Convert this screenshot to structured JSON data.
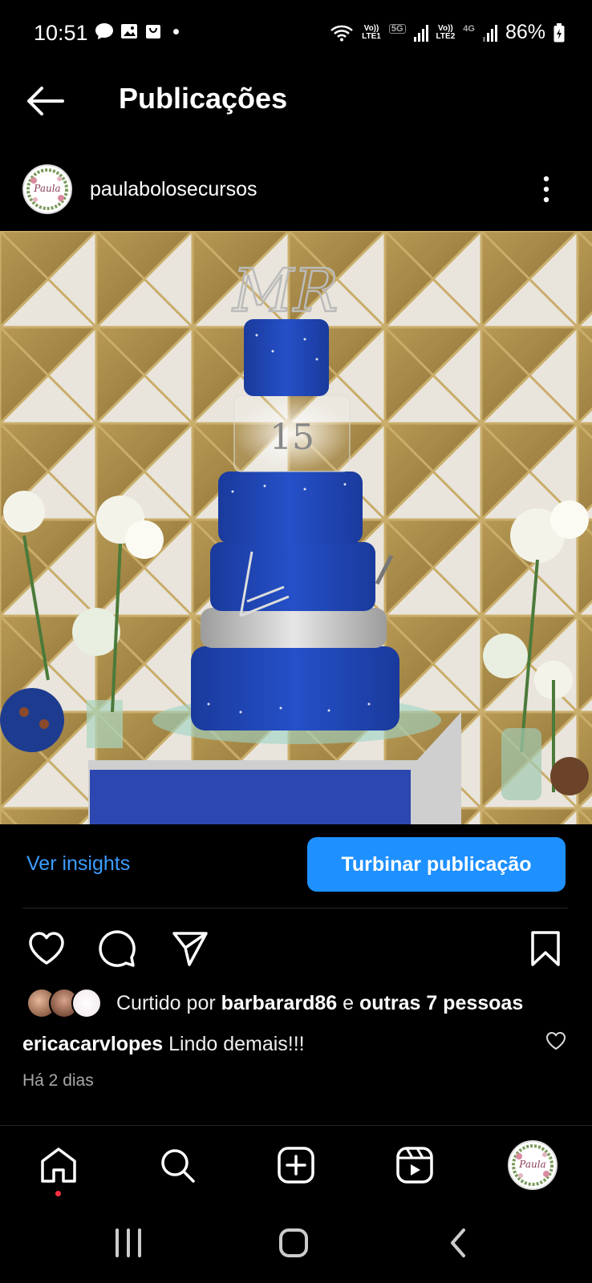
{
  "status_bar": {
    "time": "10:51",
    "sim1_label": "LTE1",
    "sim1_net": "Vo))",
    "sim1_type": "5G",
    "sim2_label": "LTE2",
    "sim2_net": "Vo))",
    "sim2_type": "4G",
    "battery": "86%"
  },
  "header": {
    "title": "Publicações"
  },
  "post": {
    "username": "paulabolosecursos",
    "avatar_alt": "Paula"
  },
  "actions": {
    "insights_label": "Ver insights",
    "boost_label": "Turbinar publicação"
  },
  "likes": {
    "prefix": "Curtido por",
    "user": "barbarard86",
    "connector": "e",
    "others": "outras 7 pessoas"
  },
  "comment": {
    "user": "ericacarvlopes",
    "text": "Lindo demais!!!"
  },
  "timestamp": "Há 2 dias",
  "colors": {
    "accent": "#1e90ff",
    "link": "#3b9cff",
    "notification": "#ff3040"
  },
  "icons": {
    "back": "arrow-left-icon",
    "more": "vertical-dots-icon",
    "like": "heart-icon",
    "comment": "comment-bubble-icon",
    "share": "paper-plane-icon",
    "save": "bookmark-icon",
    "nav_home": "home-icon",
    "nav_search": "search-icon",
    "nav_create": "plus-square-icon",
    "nav_reels": "reels-icon"
  }
}
